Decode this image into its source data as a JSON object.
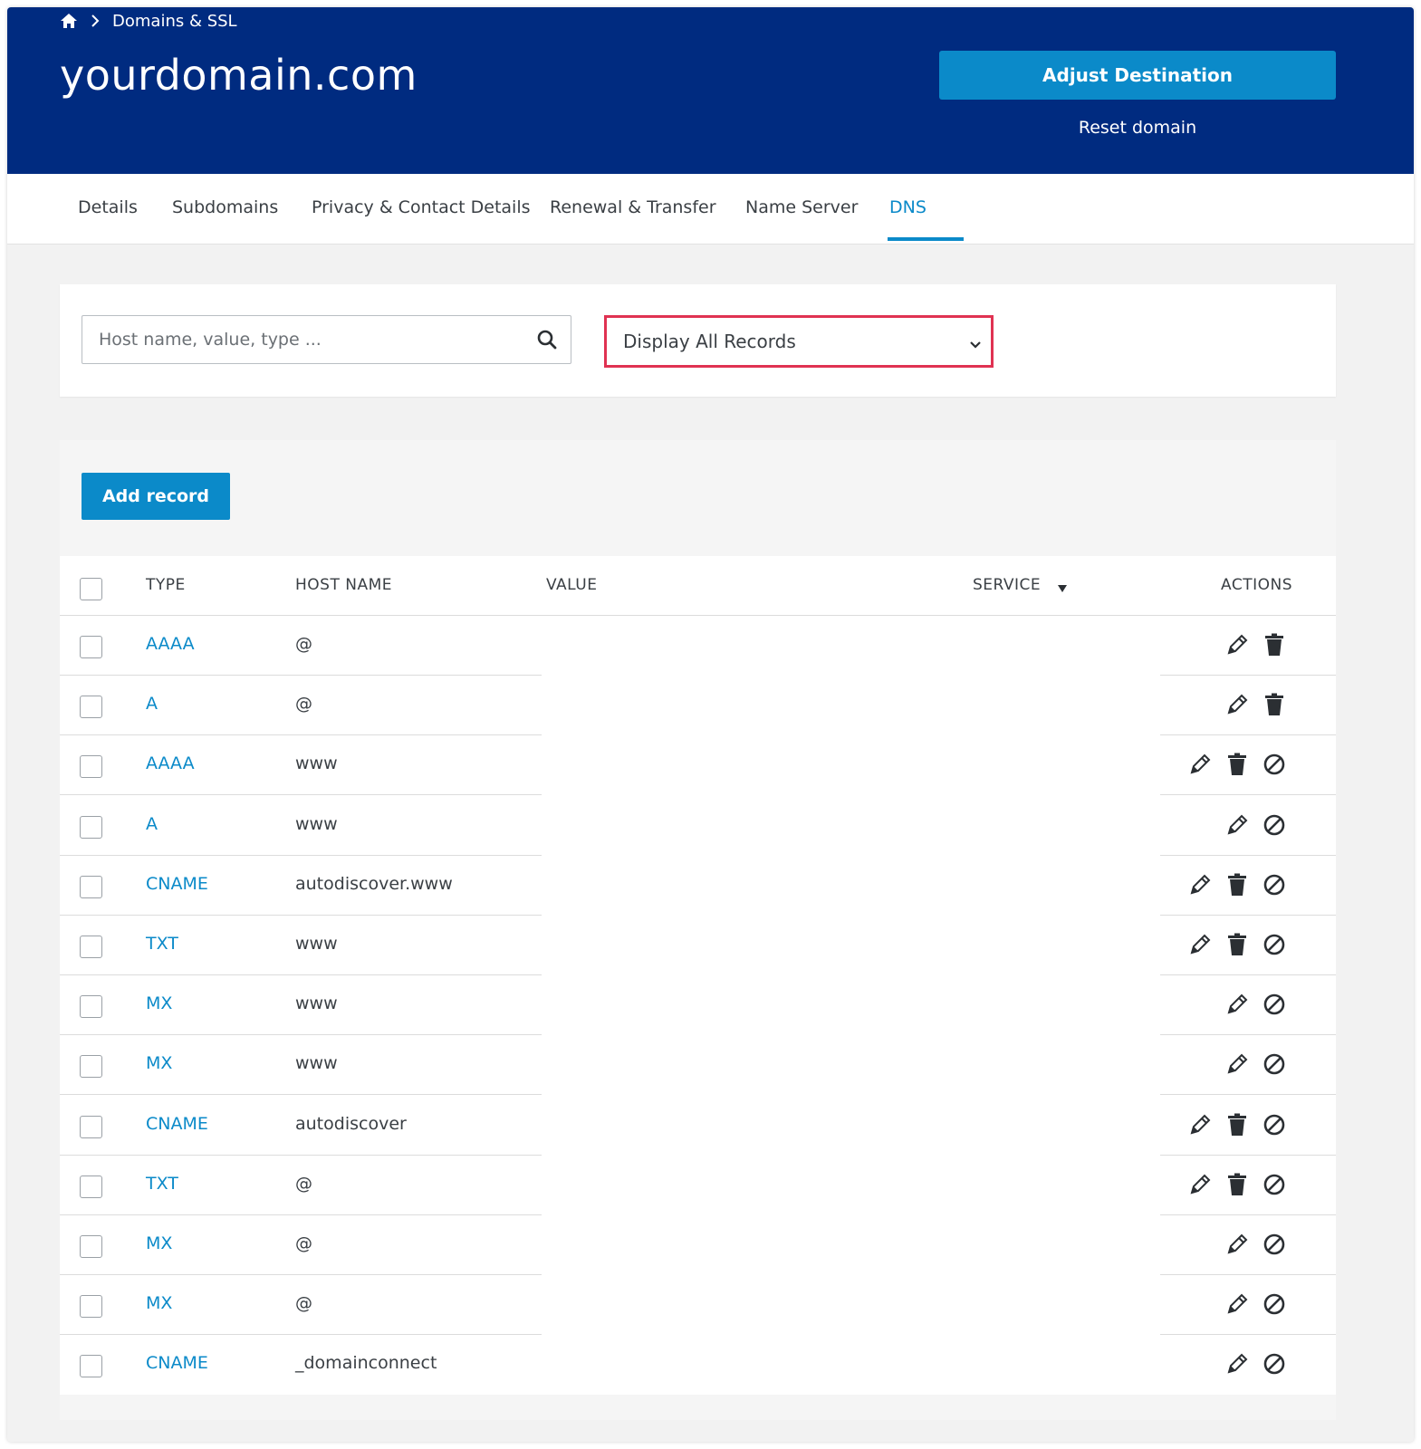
{
  "breadcrumb": {
    "home_icon": "home-icon",
    "separator_icon": "chevron-right-icon",
    "section": "Domains & SSL"
  },
  "domain": {
    "name": "yourdomain.com"
  },
  "actions": {
    "adjust_destination": "Adjust Destination",
    "reset_domain": "Reset domain"
  },
  "tabs": [
    {
      "label": "Details"
    },
    {
      "label": "Subdomains"
    },
    {
      "label": "Privacy & Contact Details"
    },
    {
      "label": "Renewal & Transfer"
    },
    {
      "label": "Name Server"
    },
    {
      "label": "DNS",
      "active": true
    }
  ],
  "filter": {
    "search_placeholder": "Host name, value, type ...",
    "display_select": "Display All Records",
    "highlight_color": "#e03252"
  },
  "records": {
    "add_button": "Add record",
    "columns": {
      "type": "TYPE",
      "host": "HOST NAME",
      "value": "VALUE",
      "service": "SERVICE",
      "actions": "ACTIONS"
    },
    "rows": [
      {
        "type": "AAAA",
        "host": "@",
        "actions": [
          "edit",
          "delete"
        ]
      },
      {
        "type": "A",
        "host": "@",
        "actions": [
          "edit",
          "delete"
        ]
      },
      {
        "type": "AAAA",
        "host": "www",
        "actions": [
          "edit",
          "delete",
          "disable"
        ]
      },
      {
        "type": "A",
        "host": "www",
        "actions": [
          "edit",
          "disable"
        ]
      },
      {
        "type": "CNAME",
        "host": "autodiscover.www",
        "actions": [
          "edit",
          "delete",
          "disable"
        ]
      },
      {
        "type": "TXT",
        "host": "www",
        "actions": [
          "edit",
          "delete",
          "disable"
        ]
      },
      {
        "type": "MX",
        "host": "www",
        "actions": [
          "edit",
          "disable"
        ]
      },
      {
        "type": "MX",
        "host": "www",
        "actions": [
          "edit",
          "disable"
        ]
      },
      {
        "type": "CNAME",
        "host": "autodiscover",
        "actions": [
          "edit",
          "delete",
          "disable"
        ]
      },
      {
        "type": "TXT",
        "host": "@",
        "actions": [
          "edit",
          "delete",
          "disable"
        ]
      },
      {
        "type": "MX",
        "host": "@",
        "actions": [
          "edit",
          "disable"
        ]
      },
      {
        "type": "MX",
        "host": "@",
        "actions": [
          "edit",
          "disable"
        ]
      },
      {
        "type": "CNAME",
        "host": "_domainconnect",
        "actions": [
          "edit",
          "disable"
        ]
      }
    ]
  },
  "colors": {
    "header_bg": "#002b80",
    "accent": "#0b8ac9",
    "page_bg": "#f2f2f2"
  }
}
